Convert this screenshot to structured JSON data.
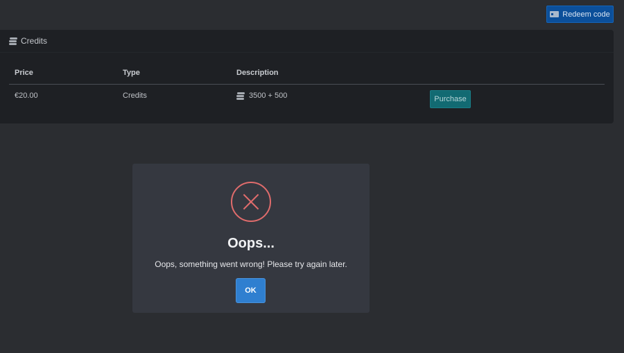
{
  "toolbar": {
    "redeem_label": "Redeem code"
  },
  "card": {
    "title": "Credits"
  },
  "table": {
    "headers": [
      "Price",
      "Type",
      "Description"
    ],
    "rows": [
      {
        "price": "€20.00",
        "type": "Credits",
        "description": "3500 + 500",
        "action": "Purchase"
      }
    ]
  },
  "modal": {
    "title": "Oops...",
    "message": "Oops, something went wrong! Please try again later.",
    "ok_label": "OK"
  },
  "icons": {
    "redeem": "ticket-icon",
    "credits": "coins-icon",
    "error": "error-x-icon"
  },
  "colors": {
    "background": "#2b2d31",
    "card": "#1e2024",
    "primary": "#2f7fd0",
    "teal": "#126a72",
    "error": "#e06c6c"
  }
}
